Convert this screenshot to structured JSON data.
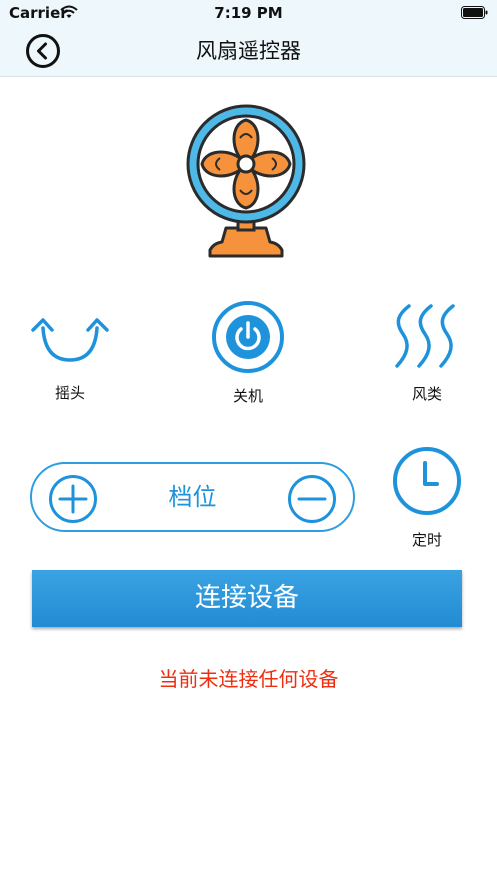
{
  "status_bar": {
    "carrier": "Carrier",
    "time": "7:19 PM"
  },
  "nav": {
    "title": "风扇遥控器",
    "back_icon": "chevron-left-circle-icon"
  },
  "fan": {
    "icon": "desk-fan-icon",
    "colors": {
      "blade": "#f6923c",
      "ring": "#4eb8e6",
      "base": "#f6923c"
    }
  },
  "controls": {
    "swing": {
      "label": "摇头",
      "icon": "swing-arrows-icon"
    },
    "power": {
      "label": "关机",
      "icon": "power-icon"
    },
    "wind_type": {
      "label": "风类",
      "icon": "wind-waves-icon"
    },
    "timer": {
      "label": "定时",
      "icon": "clock-icon"
    }
  },
  "level": {
    "label": "档位",
    "plus_icon": "plus-circle-icon",
    "minus_icon": "minus-circle-icon"
  },
  "connect_button": {
    "label": "连接设备"
  },
  "connection_status": {
    "message": "当前未连接任何设备"
  },
  "colors": {
    "accent": "#1e93dc",
    "warning": "#ef2d10",
    "button": "#2d97da",
    "nav_background": "#eef7fb"
  }
}
